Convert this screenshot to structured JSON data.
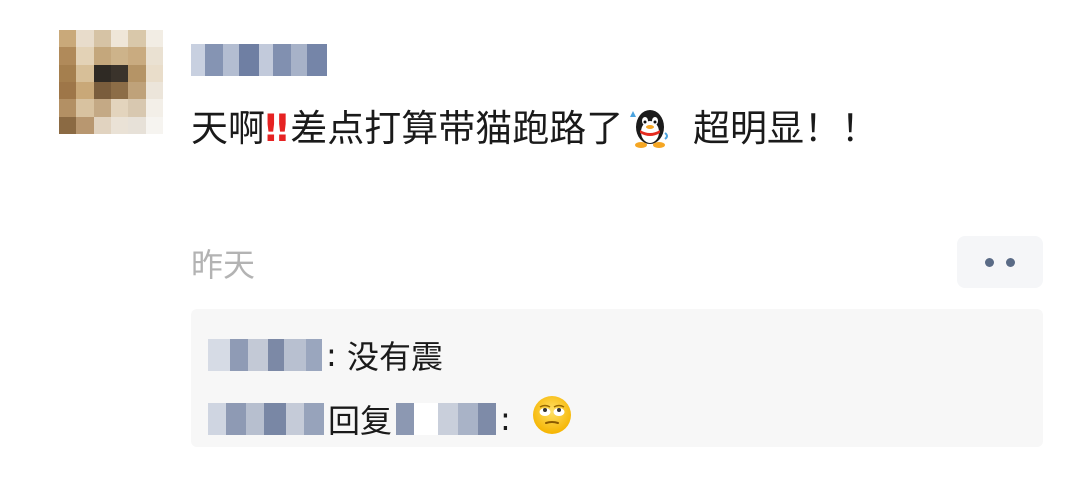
{
  "post": {
    "text_before": "天啊",
    "exclamation": "‼",
    "text_middle": "差点打算带猫跑路了",
    "qq_emoji_icon": "qq-penguin-sweat-icon",
    "text_after": " 超明显！！"
  },
  "timestamp": "昨天",
  "more_button": {
    "icon": "ellipsis-icon"
  },
  "comments": [
    {
      "separator": ": ",
      "text": "没有震"
    },
    {
      "reply_word": "回复",
      "separator": ": ",
      "emoji_icon": "rolling-eyes-emoji-icon"
    }
  ],
  "colors": {
    "text": "#1a1a1a",
    "exclamation": "#e62222",
    "timestamp": "#b3b3b3",
    "comment_bg": "#f7f7f7",
    "more_dots": "#5a6b86"
  }
}
